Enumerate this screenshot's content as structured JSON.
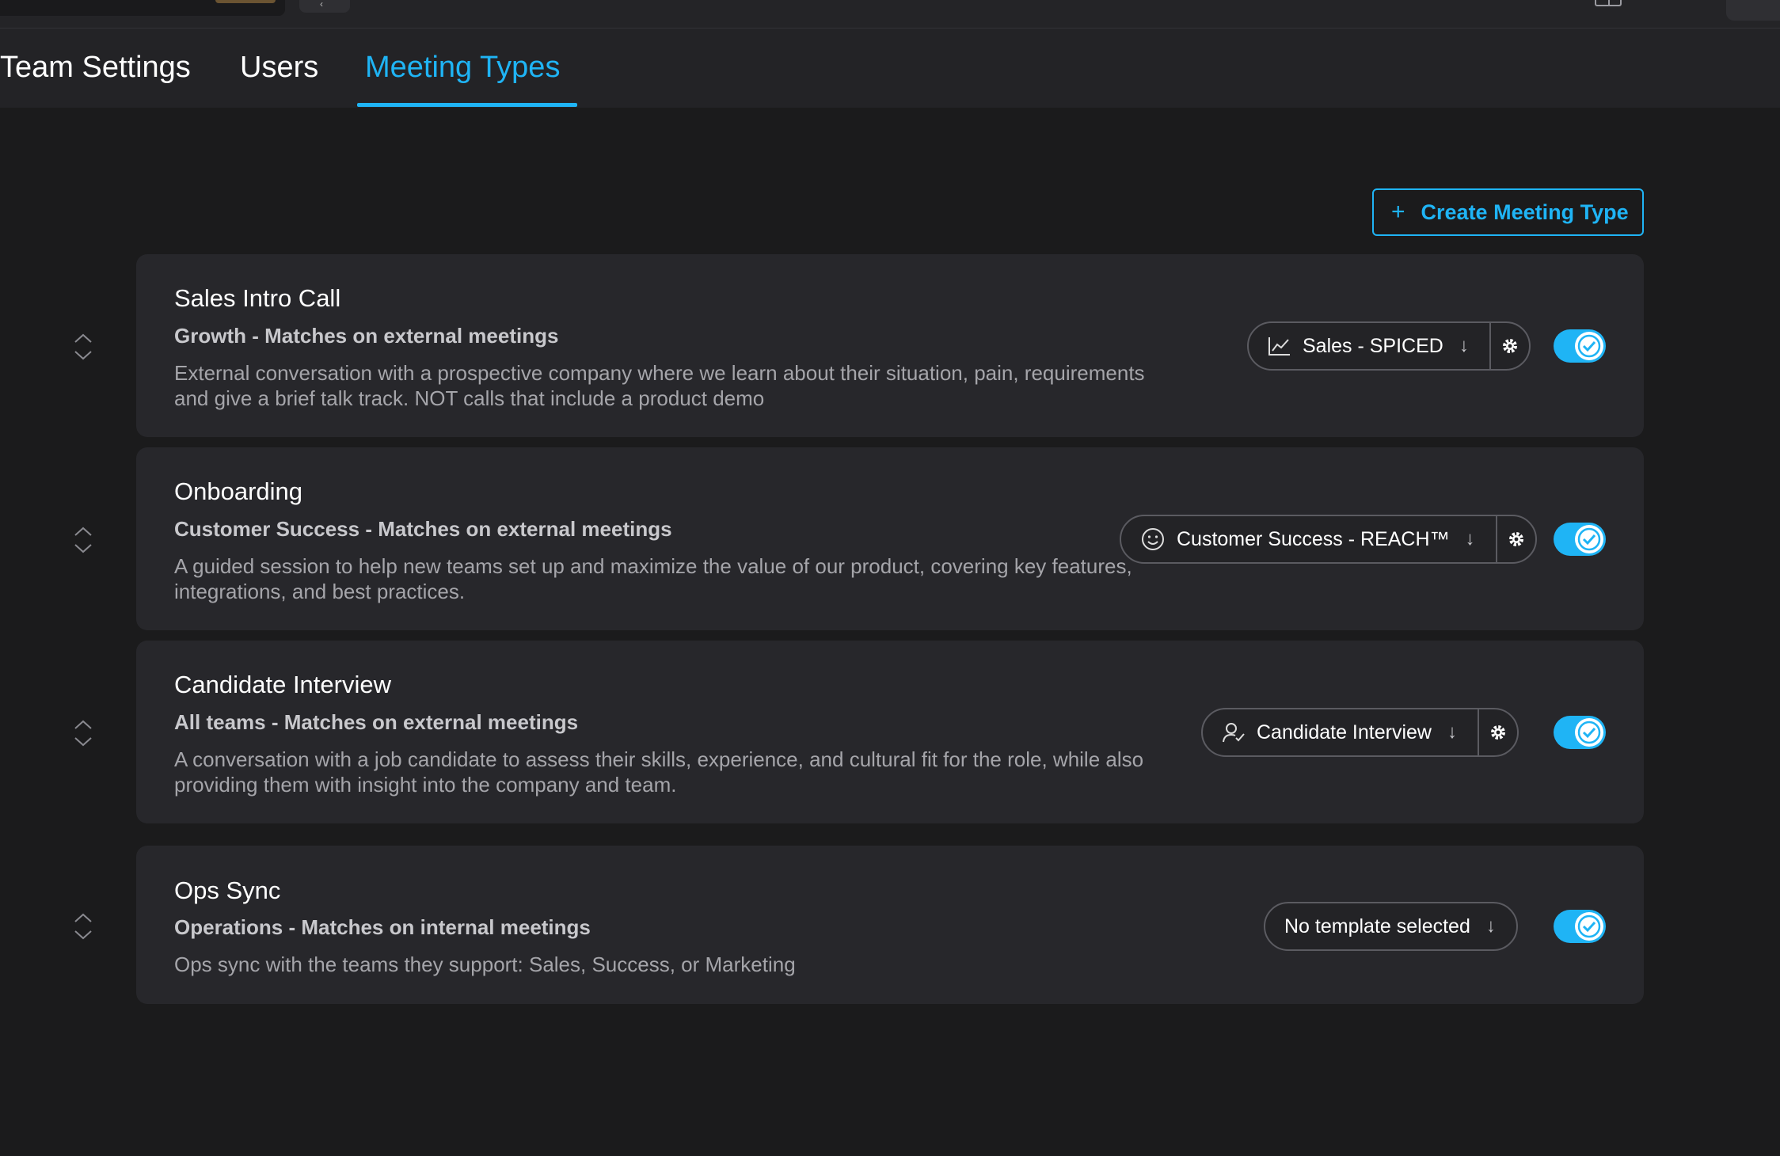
{
  "tabs": [
    {
      "label": "Team Settings",
      "active": false
    },
    {
      "label": "Users",
      "active": false
    },
    {
      "label": "Meeting Types",
      "active": true
    }
  ],
  "actions": {
    "create_label": "Create Meeting Type",
    "create_icon": "plus-icon"
  },
  "colors": {
    "accent": "#1fb4f5",
    "background": "#1b1b1c",
    "card": "#27272b"
  },
  "meeting_types": [
    {
      "name": "Sales Intro Call",
      "meta": "Growth - Matches on external meetings",
      "description": "External conversation with a prospective company where we learn about their situation, pain, requirements and give a brief talk track. NOT calls that include a product demo",
      "template": "Sales - SPICED",
      "template_icon": "chart-line-icon",
      "enabled": true
    },
    {
      "name": "Onboarding",
      "meta": "Customer Success - Matches on external meetings",
      "description": "A guided session to help new teams set up and maximize the value of our product, covering key features, integrations, and best practices.",
      "template": "Customer Success - REACH™",
      "template_icon": "smiley-icon",
      "enabled": true
    },
    {
      "name": "Candidate Interview",
      "meta": "All teams - Matches on external meetings",
      "description": "A conversation with a job candidate to assess their skills, experience, and cultural fit for the role, while also providing them with insight into the company and team.",
      "template": "Candidate Interview",
      "template_icon": "user-check-icon",
      "enabled": true
    },
    {
      "name": "Ops Sync",
      "meta": "Operations - Matches on internal meetings",
      "description": "Ops sync with the teams they support: Sales, Success, or Marketing",
      "template": "No template selected",
      "template_icon": "",
      "enabled": true
    }
  ]
}
